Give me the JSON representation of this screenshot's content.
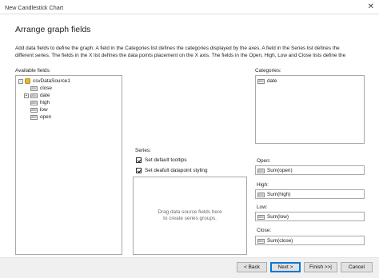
{
  "window": {
    "title": "New Candlestick Chart",
    "close_glyph": "✕"
  },
  "page": {
    "title": "Arrange graph fields",
    "description": [
      "Add data fields to define the graph. A field in the Categories list defines the categories displayed by the axes. A field in the Series list defines the",
      "different series. The fields in the X list defines the data points placement on the X axis. The fields in the Open, High, Low and Close lists define the"
    ]
  },
  "available": {
    "label": "Available fields:",
    "root": {
      "expander": "−",
      "name": "csvDataSource1"
    },
    "fields": [
      {
        "name": "close",
        "icon": "abc",
        "expander": ""
      },
      {
        "name": "date",
        "icon": "abc",
        "expander": "+"
      },
      {
        "name": "high",
        "icon": "abc",
        "expander": ""
      },
      {
        "name": "low",
        "icon": "abc",
        "expander": ""
      },
      {
        "name": "open",
        "icon": "abc",
        "expander": ""
      }
    ]
  },
  "categories": {
    "label": "Categories:",
    "items": [
      {
        "name": "date",
        "icon": "abc"
      }
    ]
  },
  "series": {
    "label": "Series:",
    "options": [
      {
        "label": "Set default tooltips",
        "checked": true
      },
      {
        "label": "Set deafult datapoint styling",
        "checked": true
      }
    ],
    "drop_hint": [
      "Drag data source fields here",
      "to create series groups."
    ]
  },
  "ohlc": {
    "open": {
      "label": "Open:",
      "value": "Sum(open)",
      "icon": "abc"
    },
    "high": {
      "label": "High:",
      "value": "Sum(high)",
      "icon": "abc"
    },
    "low": {
      "label": "Low:",
      "value": "Sum(low)",
      "icon": "abc"
    },
    "close": {
      "label": "Close:",
      "value": "Sum(close)",
      "icon": "abc"
    }
  },
  "buttons": {
    "back": "< Back",
    "next": "Next >",
    "finish": "Finish >>|",
    "cancel": "Cancel"
  }
}
